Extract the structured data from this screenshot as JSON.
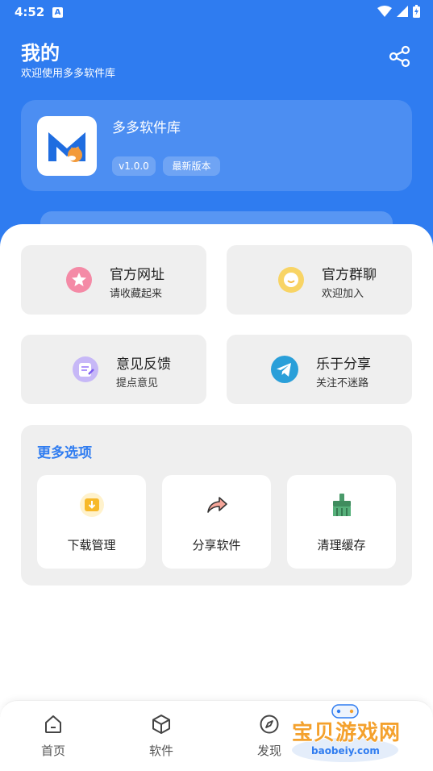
{
  "status_bar": {
    "time": "4:52",
    "notif": "A"
  },
  "header": {
    "title": "我的",
    "subtitle": "欢迎使用多多软件库"
  },
  "app": {
    "name": "多多软件库",
    "version": "v1.0.0",
    "badge": "最新版本"
  },
  "tiles": [
    {
      "title": "官方网址",
      "desc": "请收藏起来",
      "icon": "star-icon",
      "color": "#f06b8f"
    },
    {
      "title": "官方群聊",
      "desc": "欢迎加入",
      "icon": "chat-bubble-icon",
      "color": "#f6c342"
    },
    {
      "title": "意见反馈",
      "desc": "提点意见",
      "icon": "feedback-icon",
      "color": "#a78bfa"
    },
    {
      "title": "乐于分享",
      "desc": "关注不迷路",
      "icon": "telegram-icon",
      "color": "#2a9fd9"
    }
  ],
  "more": {
    "heading": "更多选项",
    "options": [
      {
        "label": "下载管理",
        "icon": "download-icon"
      },
      {
        "label": "分享软件",
        "icon": "share-arrow-icon"
      },
      {
        "label": "清理缓存",
        "icon": "broom-icon"
      }
    ]
  },
  "nav": [
    {
      "label": "首页",
      "icon": "home-icon"
    },
    {
      "label": "软件",
      "icon": "cube-icon"
    },
    {
      "label": "发现",
      "icon": "compass-icon"
    }
  ],
  "watermark": {
    "text": "宝贝游戏网",
    "url": "baobeiy.com"
  },
  "colors": {
    "primary": "#2f7cf0",
    "tile_bg": "#efefef"
  }
}
